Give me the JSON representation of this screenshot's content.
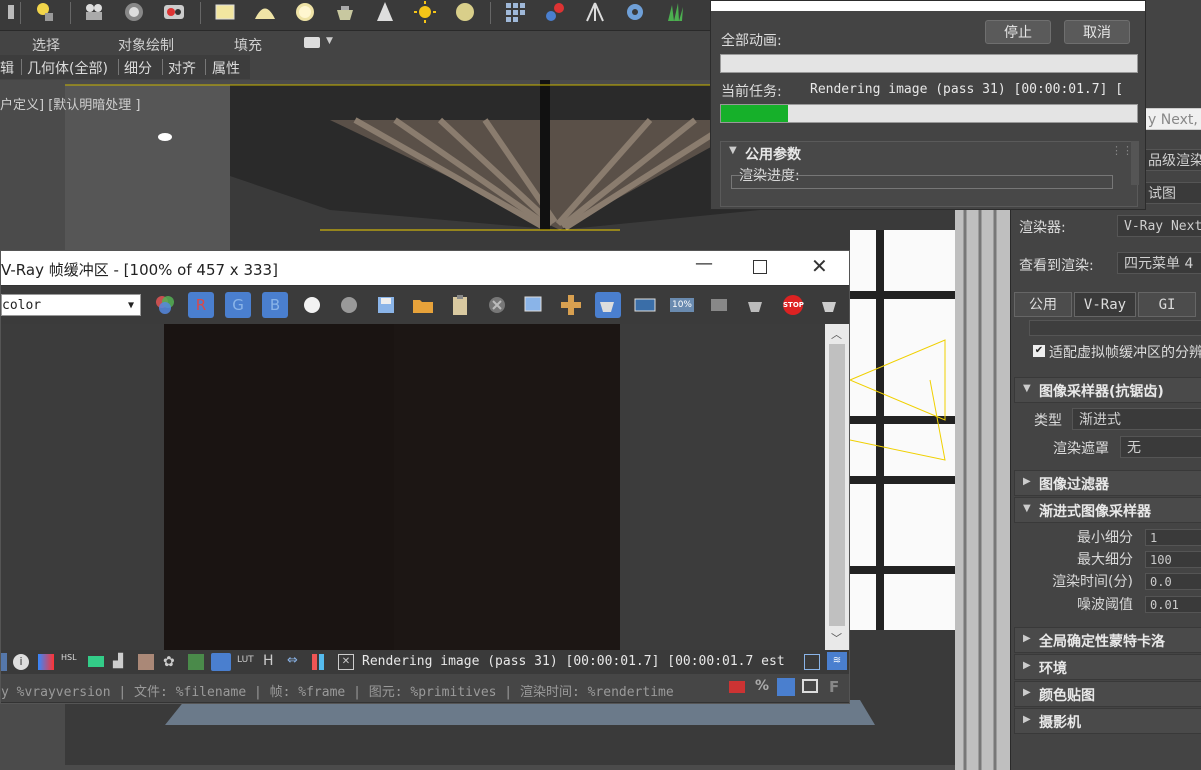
{
  "main_toolbar": {
    "icons": [
      "layers-icon",
      "lamp-icon",
      "camera-icon",
      "sphere-camera-icon",
      "render-icon",
      "rectangle-icon",
      "dome-light-icon",
      "sphere-light-icon",
      "teapot-icon",
      "cone-light-icon",
      "sun-icon",
      "disc-light-icon",
      "grid-icon",
      "molecule-icon",
      "tripod-icon",
      "gear-icon",
      "grass-icon"
    ]
  },
  "ribbon": {
    "tabs": [
      "选择",
      "对象绘制",
      "填充"
    ],
    "sub_tabs": [
      "辑",
      "几何体(全部)",
      "细分",
      "对齐",
      "属性"
    ]
  },
  "viewport": {
    "label": "户定义] [默认明暗处理 ]"
  },
  "render_dialog": {
    "all_animation_label": "全部动画:",
    "stop_button": "停止",
    "cancel_button": "取消",
    "current_task_label": "当前任务:",
    "current_task_text": "Rendering image (pass 31) [00:00:01.7] [",
    "task_progress": 0.16,
    "common_params_label": "公用参数",
    "render_progress_label": "渲染进度:"
  },
  "right_panel": {
    "search_placeholder": "y Next,",
    "preset_field": "品级渲染",
    "view_field": "试图",
    "renderer_label": "渲染器:",
    "renderer_value": "V-Ray Next",
    "view_to_render_label": "查看到渲染:",
    "view_to_render_value": "四元菜单 4",
    "tabs": [
      "公用",
      "V-Ray",
      "GI"
    ],
    "fit_vfb_checkbox": "适配虚拟帧缓冲区的分辨",
    "sampler_rollout": "图像采样器(抗锯齿)",
    "type_label": "类型",
    "type_value": "渐进式",
    "render_mask_label": "渲染遮罩",
    "render_mask_value": "无",
    "filter_rollout": "图像过滤器",
    "progressive_rollout": "渐进式图像采样器",
    "min_subdiv_label": "最小细分",
    "min_subdiv_value": "1",
    "max_subdiv_label": "最大细分",
    "max_subdiv_value": "100",
    "render_time_label": "渲染时间(分)",
    "render_time_value": "0.0",
    "noise_label": "噪波阈值",
    "noise_value": "0.01",
    "rollouts": [
      "全局确定性蒙特卡洛",
      "环境",
      "颜色贴图",
      "摄影机"
    ]
  },
  "vfb": {
    "title": "V-Ray 帧缓冲区 - [100% of 457 x 333]",
    "channel": "color",
    "rgb_labels": [
      "R",
      "G",
      "B"
    ],
    "status_text": "Rendering image (pass 31) [00:00:01.7] [00:00:01.7 est",
    "info_line": "y %vrayversion | 文件: %filename | 帧: %frame | 图元: %primitives | 渲染时间: %rendertime",
    "zoom_badge": "10%",
    "stop_badge": "STOP",
    "h_glyph": "H",
    "lut_glyph": "LUT",
    "hsl_glyph": "HSL",
    "f_glyph": "F",
    "percent_glyph": "%",
    "colors": {
      "r": "#d94a4a",
      "g": "#8ab4e8",
      "b": "#8ab4e8",
      "btn_bg": "#4a7fcf"
    }
  }
}
